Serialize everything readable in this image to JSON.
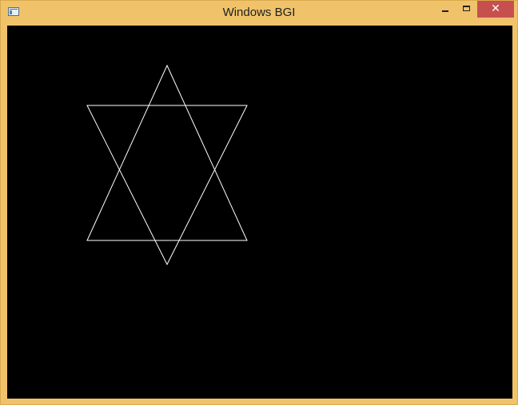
{
  "window": {
    "title": "Windows BGI",
    "controls": {
      "minimize_icon": "minimize-icon",
      "maximize_icon": "maximize-icon",
      "close_icon": "close-icon",
      "close_glyph": "✕"
    },
    "colors": {
      "frame": "#f0c36b",
      "close_button": "#c7504f"
    }
  },
  "canvas": {
    "background": "#000000",
    "stroke_color": "#ffffff",
    "shapes": [
      {
        "name": "upward-triangle",
        "kind": "triangle"
      },
      {
        "name": "downward-triangle",
        "kind": "triangle"
      }
    ]
  }
}
